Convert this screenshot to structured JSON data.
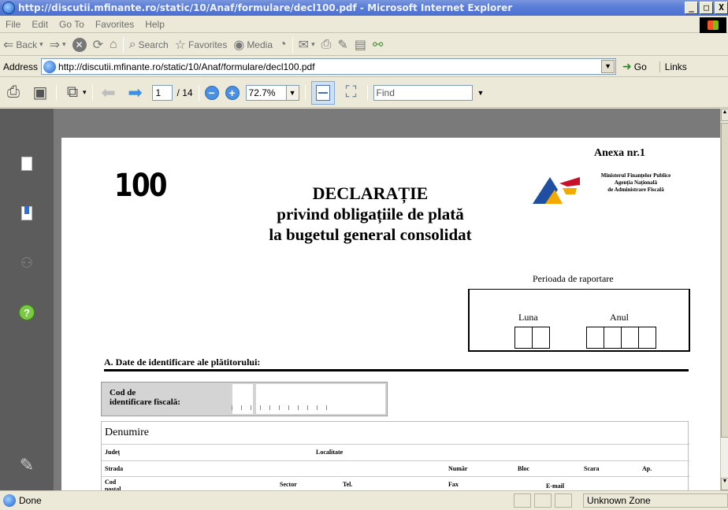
{
  "window": {
    "title": "http://discutii.mfinante.ro/static/10/Anaf/formulare/decl100.pdf - Microsoft Internet Explorer",
    "controls": [
      "_",
      "□",
      "X"
    ]
  },
  "menu": [
    "File",
    "Edit",
    "Go To",
    "Favorites",
    "Help"
  ],
  "toolbar": {
    "back": "Back",
    "search": "Search",
    "favorites": "Favorites",
    "media": "Media"
  },
  "address": {
    "label": "Address",
    "url": "http://discutii.mfinante.ro/static/10/Anaf/formulare/decl100.pdf",
    "go": "Go",
    "links": "Links"
  },
  "pdf_toolbar": {
    "page_current": "1",
    "page_total": "/ 14",
    "zoom": "72.7%",
    "find_placeholder": "Find"
  },
  "document": {
    "annex": "Anexa nr.1",
    "form_number": "100",
    "title_line1": "DECLARAȚIE",
    "title_line2": "privind obligațiile de plată",
    "title_line3": "la bugetul general consolidat",
    "ministry_line1": "Ministerul Finanțelor Publice",
    "ministry_line2": "Agenția Națională",
    "ministry_line3": "de Administrare Fiscală",
    "period_label": "Perioada de raportare",
    "month_label": "Luna",
    "year_label": "Anul",
    "section_a": "A. Date  de identificare ale plătitorului:",
    "fiscal_code_line1": "Cod de",
    "fiscal_code_line2": "identificare  fiscală:",
    "name_label": "Denumire",
    "county": "Județ",
    "locality": "Localitate",
    "street": "Strada",
    "number": "Număr",
    "block": "Bloc",
    "staircase": "Scara",
    "apartment": "Ap.",
    "postal_code": "Cod poștal",
    "sector": "Sector",
    "phone": "Tel.",
    "fax": "Fax",
    "email": "E-mail"
  },
  "status": {
    "text": "Done",
    "zone": "Unknown Zone"
  }
}
